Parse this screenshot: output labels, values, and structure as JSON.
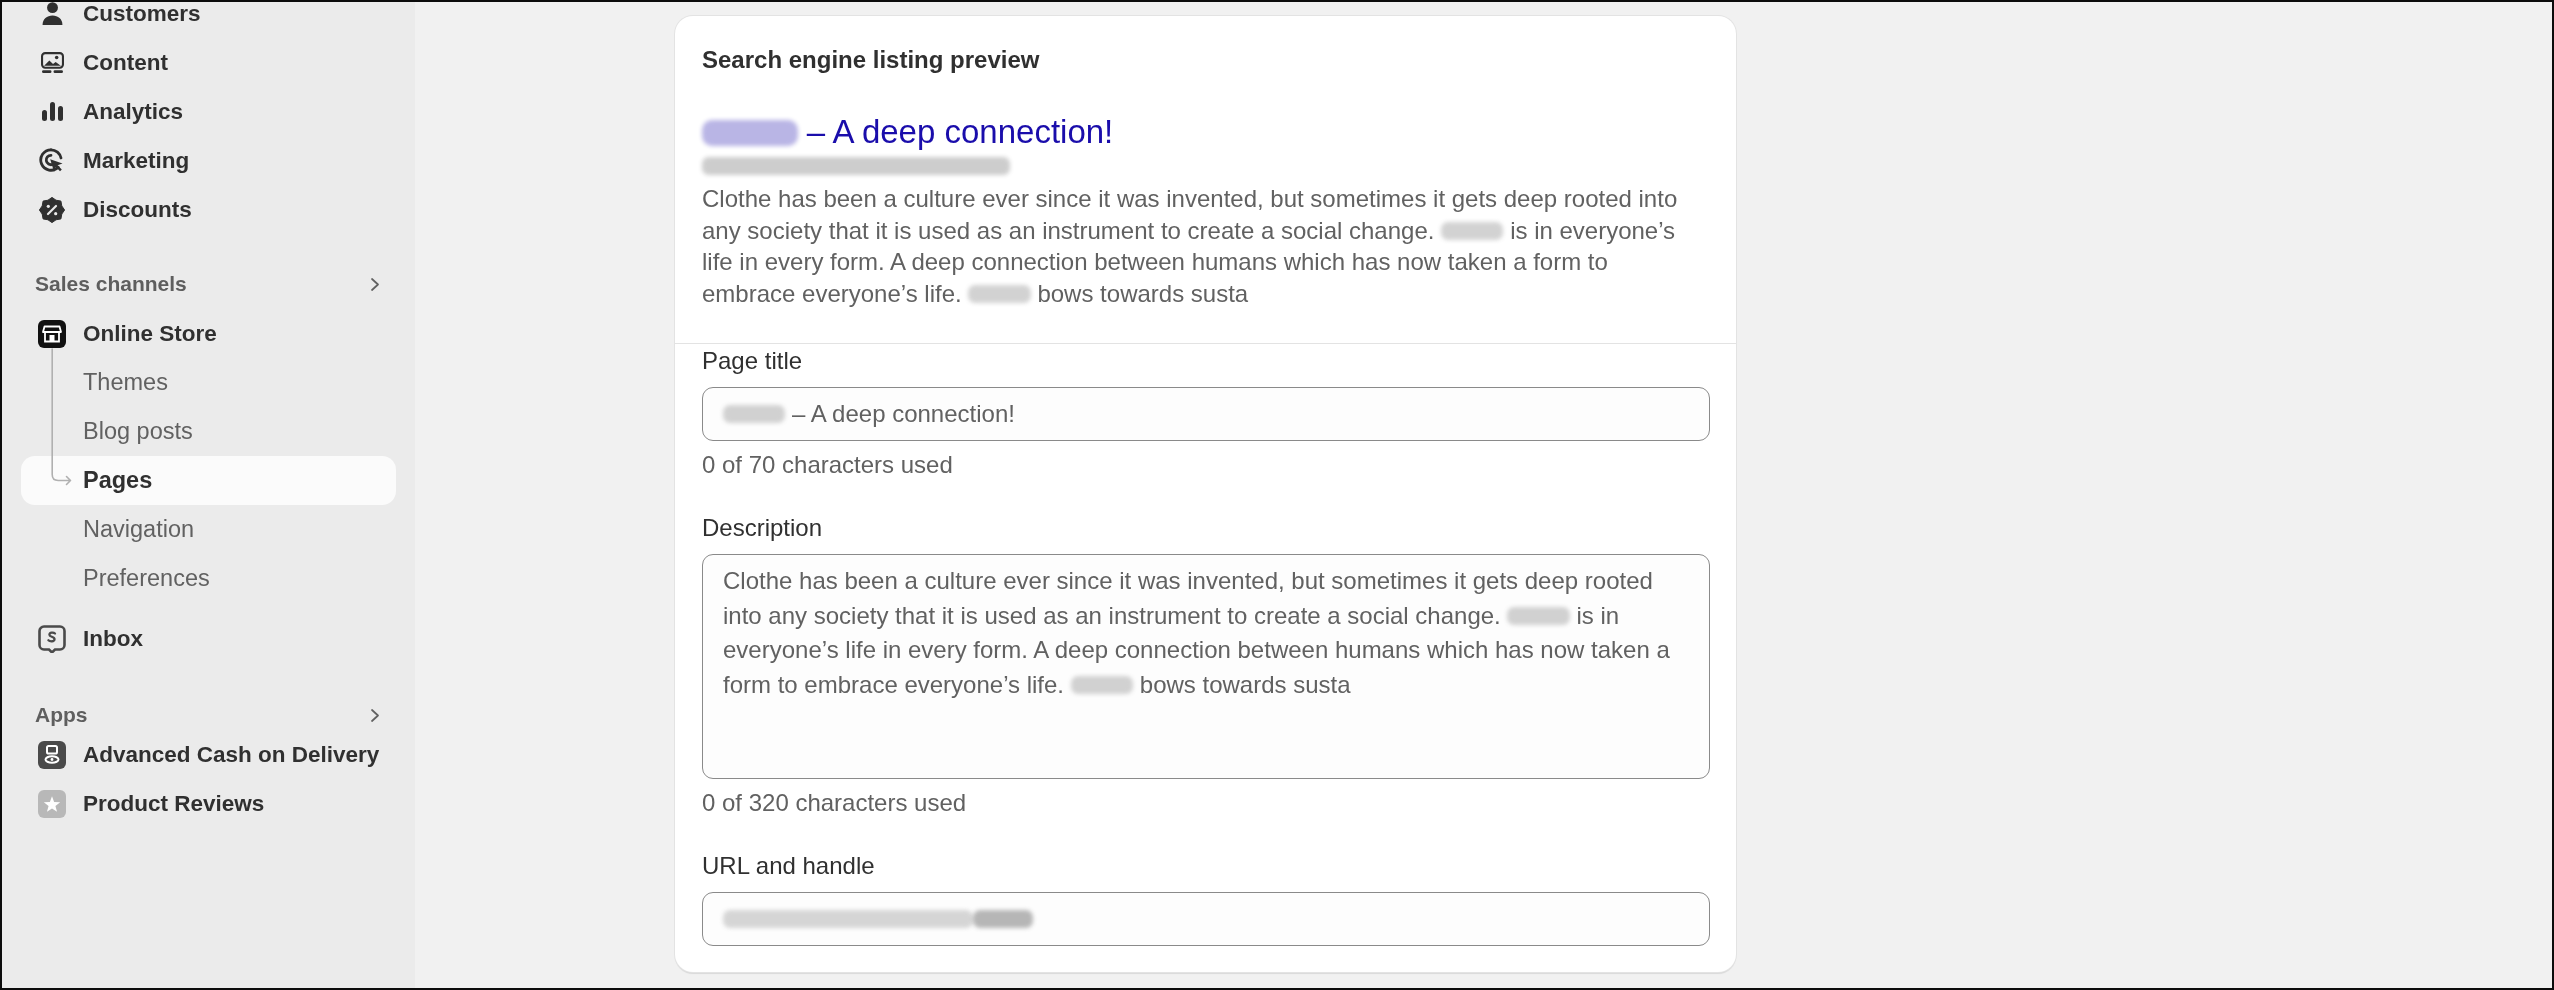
{
  "sidebar": {
    "sections": [
      {
        "items": [
          {
            "label": "Customers",
            "selected": false
          },
          {
            "label": "Content",
            "selected": false
          },
          {
            "label": "Analytics",
            "selected": false
          },
          {
            "label": "Marketing",
            "selected": false
          },
          {
            "label": "Discounts",
            "selected": false
          }
        ]
      },
      {
        "heading": "Sales channels",
        "items": [
          {
            "label": "Online Store",
            "selected": false,
            "expanded": true,
            "children": [
              {
                "label": "Themes",
                "selected": false
              },
              {
                "label": "Blog posts",
                "selected": false
              },
              {
                "label": "Pages",
                "selected": true
              },
              {
                "label": "Navigation",
                "selected": false
              },
              {
                "label": "Preferences",
                "selected": false
              }
            ]
          },
          {
            "label": "Inbox",
            "selected": false
          }
        ]
      },
      {
        "heading": "Apps",
        "items": [
          {
            "label": "Advanced Cash on Delivery",
            "selected": false
          },
          {
            "label": "Product Reviews",
            "selected": false
          }
        ]
      }
    ]
  },
  "seo_card": {
    "title": "Search engine listing preview",
    "preview": {
      "title": [
        {
          "redacted": true
        },
        {
          "text": " – A deep connection!"
        }
      ],
      "url": [
        {
          "redacted": true
        }
      ],
      "description": [
        {
          "text": "Clothe has been a culture ever since it was invented, but sometimes it gets deep rooted into any society that it is used as an instrument to create a social change. "
        },
        {
          "redacted": true
        },
        {
          "text": " is in everyone’s life in every form. A deep connection between humans which has now taken a form to embrace everyone’s life. "
        },
        {
          "redacted": true
        },
        {
          "text": " bows towards susta"
        }
      ]
    },
    "fields": [
      {
        "kind": "text",
        "label": "Page title",
        "placeholder": [
          {
            "redacted": true
          },
          {
            "text": " – A deep connection!"
          }
        ],
        "helper": "0 of 70 characters used"
      },
      {
        "kind": "textarea",
        "label": "Description",
        "placeholder": [
          {
            "text": "Clothe has been a culture ever since it was invented, but sometimes it gets deep rooted into any society that it is used as an instrument to create a social change. "
          },
          {
            "redacted": true
          },
          {
            "text": " is in everyone’s life in every form. A deep connection between humans which has now taken a form to embrace everyone’s life. "
          },
          {
            "redacted": true
          },
          {
            "text": " bows towards susta"
          }
        ],
        "helper": "0 of 320 characters used"
      },
      {
        "kind": "url",
        "label": "URL and handle",
        "prefix": [
          {
            "redacted": true
          }
        ],
        "value": [
          {
            "redacted": true
          }
        ]
      }
    ]
  }
}
